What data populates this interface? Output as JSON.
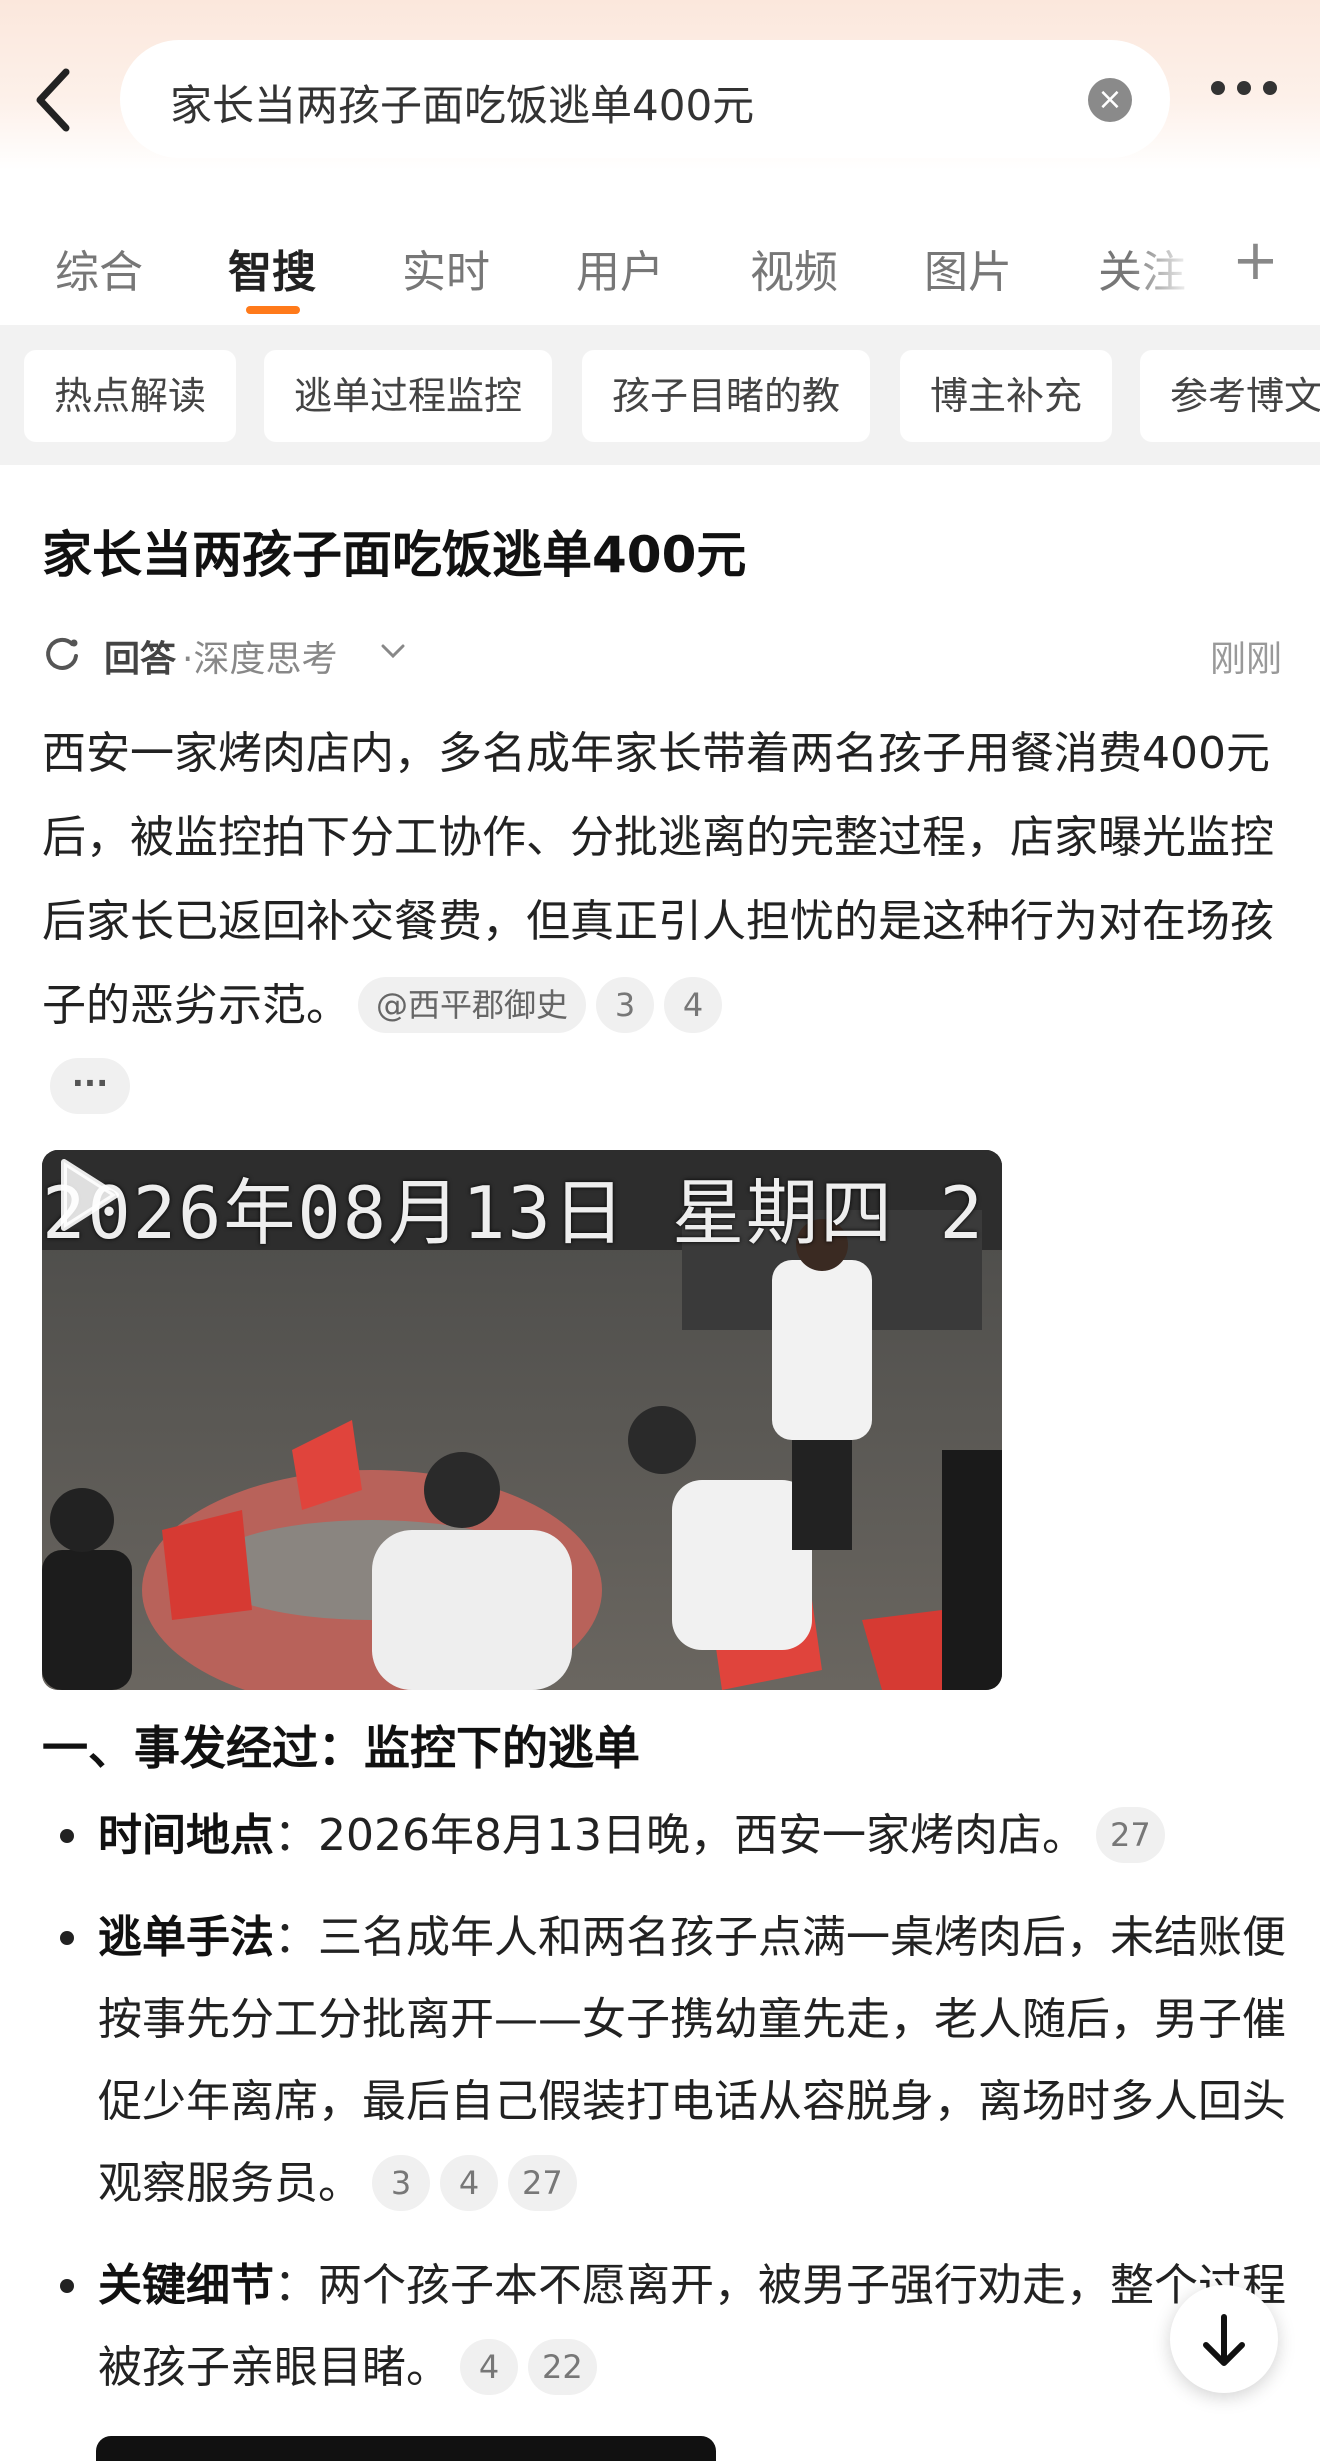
{
  "search": {
    "query": "家长当两孩子面吃饭逃单400元"
  },
  "tabs": [
    {
      "label": "综合"
    },
    {
      "label": "智搜"
    },
    {
      "label": "实时"
    },
    {
      "label": "用户"
    },
    {
      "label": "视频"
    },
    {
      "label": "图片"
    },
    {
      "label": "关注"
    }
  ],
  "active_tab": "智搜",
  "chips": [
    "热点解读",
    "逃单过程监控",
    "孩子目睹的教",
    "博主补充",
    "参考博文"
  ],
  "article": {
    "title": "家长当两孩子面吃饭逃单400元",
    "answer_label": "回答",
    "mode_label": "·深度思考",
    "time": "刚刚",
    "summary": "西安一家烤肉店内，多名成年家长带着两名孩子用餐消费400元后，被监控拍下分工协作、分批逃离的完整过程，店家曝光监控后家长已返回补交餐费，但真正引人担忧的是这种行为对在场孩子的恶劣示范。",
    "source": "@西平郡御史",
    "refs": [
      "3",
      "4"
    ],
    "more": "···"
  },
  "video": {
    "timestamp": "2026年08月13日 星期四 2"
  },
  "section": {
    "heading": "一、事发经过：监控下的逃单",
    "bullets": [
      {
        "label": "时间地点",
        "sep": "：",
        "text": "2026年8月13日晚，西安一家烤肉店。",
        "refs": [
          "27"
        ]
      },
      {
        "label": "逃单手法",
        "sep": "：",
        "text": "三名成年人和两名孩子点满一桌烤肉后，未结账便按事先分工分批离开——女子携幼童先走，老人随后，男子催促少年离席，最后自己假装打电话从容脱身，离场时多人回头观察服务员。",
        "refs": [
          "3",
          "4",
          "27"
        ]
      },
      {
        "label": "关键细节",
        "sep": "：",
        "text": "两个孩子本不愿离开，被男子强行劝走，整个过程被孩子亲眼目睹。",
        "refs": [
          "4",
          "22"
        ]
      }
    ]
  },
  "colors": {
    "accent": "#ff7a1a",
    "header_bg": "#fbe7dc",
    "chip_bg": "#f2f2f2"
  },
  "icons": [
    "back-arrow-icon",
    "clear-icon",
    "more-icon",
    "plus-icon",
    "ai-spinner-icon",
    "chevron-down-icon",
    "play-icon",
    "arrow-down-icon"
  ]
}
